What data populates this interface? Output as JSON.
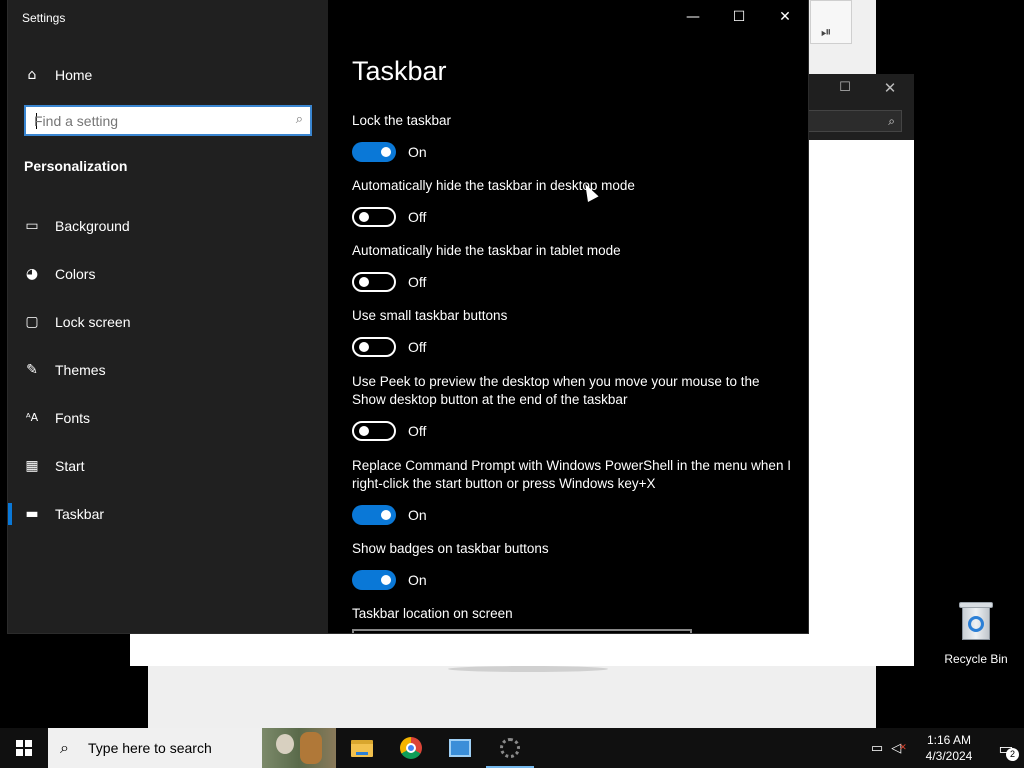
{
  "window": {
    "title": "Settings",
    "minimize_glyph": "—",
    "maximize_glyph": "☐",
    "close_glyph": "✕"
  },
  "sidebar": {
    "home_label": "Home",
    "home_icon": "home-icon",
    "search": {
      "placeholder": "Find a setting",
      "icon": "search-icon"
    },
    "section_heading": "Personalization",
    "items": [
      {
        "label": "Background",
        "icon": "image-icon",
        "glyph": "▭",
        "selected": false
      },
      {
        "label": "Colors",
        "icon": "palette-icon",
        "glyph": "◕",
        "selected": false
      },
      {
        "label": "Lock screen",
        "icon": "lock-screen-icon",
        "glyph": "▢",
        "selected": false
      },
      {
        "label": "Themes",
        "icon": "pen-icon",
        "glyph": "✎",
        "selected": false
      },
      {
        "label": "Fonts",
        "icon": "font-icon",
        "glyph": "ᴬA",
        "selected": false
      },
      {
        "label": "Start",
        "icon": "start-tiles-icon",
        "glyph": "▦",
        "selected": false
      },
      {
        "label": "Taskbar",
        "icon": "taskbar-icon",
        "glyph": "▬",
        "selected": true
      }
    ]
  },
  "main": {
    "page_title": "Taskbar",
    "settings": [
      {
        "label": "Lock the taskbar",
        "state": "On"
      },
      {
        "label": "Automatically hide the taskbar in desktop mode",
        "state": "Off"
      },
      {
        "label": "Automatically hide the taskbar in tablet mode",
        "state": "Off"
      },
      {
        "label": "Use small taskbar buttons",
        "state": "Off"
      },
      {
        "label": "Use Peek to preview the desktop when you move your mouse to the Show desktop button at the end of the taskbar",
        "state": "Off"
      },
      {
        "label": "Replace Command Prompt with Windows PowerShell in the menu when I right-click the start button or press Windows key+X",
        "state": "On"
      },
      {
        "label": "Show badges on taskbar buttons",
        "state": "On"
      }
    ],
    "location_label": "Taskbar location on screen"
  },
  "desktop": {
    "recycle_bin_label": "Recycle Bin"
  },
  "taskbar": {
    "search_placeholder": "Type here to search",
    "apps": [
      {
        "name": "file-explorer",
        "active": false
      },
      {
        "name": "chrome",
        "active": false
      },
      {
        "name": "control-panel",
        "active": false
      },
      {
        "name": "settings",
        "active": true
      }
    ],
    "clock_time": "1:16 AM",
    "clock_date": "4/3/2024",
    "notification_count": "2"
  },
  "colors": {
    "accent": "#0a78d7",
    "sidebar_bg": "#202020",
    "main_bg": "#000000"
  }
}
